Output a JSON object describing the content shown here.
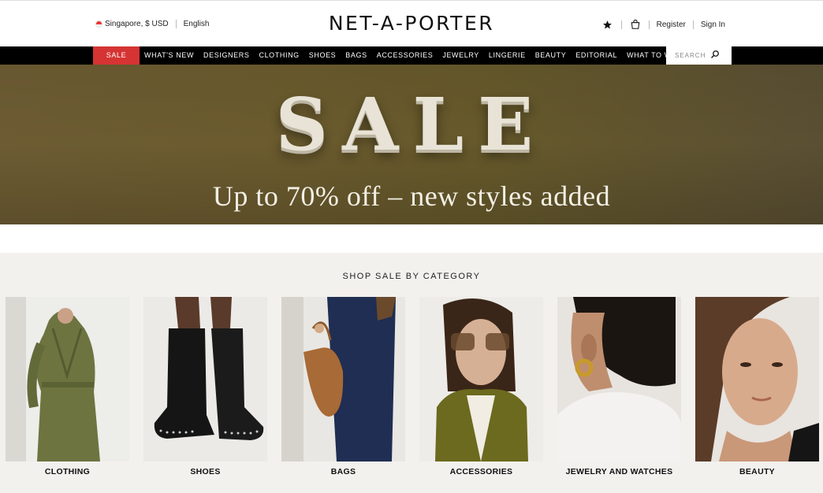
{
  "header": {
    "locale": "Singapore, $ USD",
    "language": "English",
    "logo": "NET-A-PORTER",
    "register": "Register",
    "sign_in": "Sign In"
  },
  "nav": {
    "items": [
      "SALE",
      "WHAT'S NEW",
      "DESIGNERS",
      "CLOTHING",
      "SHOES",
      "BAGS",
      "ACCESSORIES",
      "JEWELRY",
      "LINGERIE",
      "BEAUTY",
      "EDITORIAL",
      "WHAT TO WEAR"
    ],
    "search_placeholder": "SEARCH"
  },
  "hero": {
    "title": "SALE",
    "subtitle": "Up to 70% off – new styles added"
  },
  "categories": {
    "heading": "SHOP SALE BY CATEGORY",
    "items": [
      "CLOTHING",
      "SHOES",
      "BAGS",
      "ACCESSORIES",
      "JEWELRY AND WATCHES",
      "BEAUTY"
    ]
  },
  "colors": {
    "sale_red": "#d63333",
    "nav_black": "#000000",
    "section_bg": "#f3f1ee"
  },
  "icons": [
    "flag-singapore-icon",
    "star-icon",
    "shopping-bag-icon",
    "search-icon"
  ]
}
